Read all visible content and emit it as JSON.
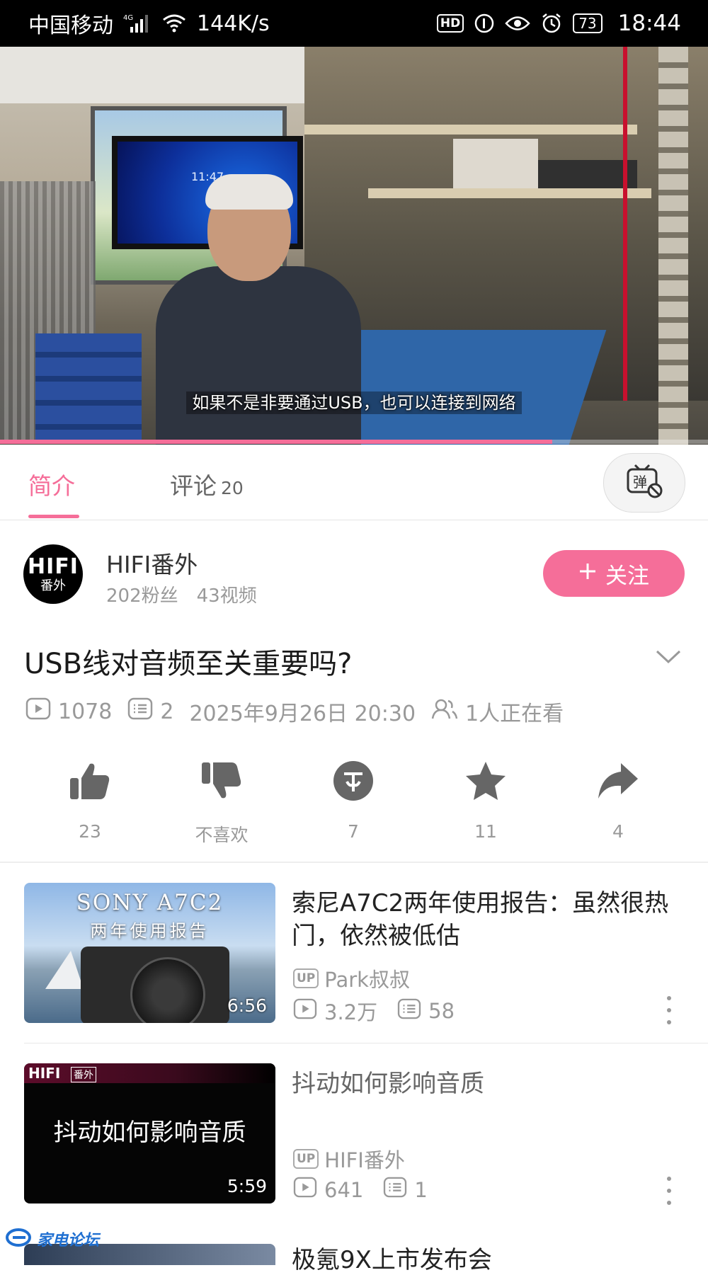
{
  "status_bar": {
    "carrier": "中国移动",
    "network": "4G",
    "speed": "144K/s",
    "battery": "73",
    "time": "18:44"
  },
  "player": {
    "subtitle": "如果不是非要通过USB，也可以连接到网络",
    "monitor_time": "11:47",
    "progress_fraction": 0.78
  },
  "tabs": {
    "intro": "简介",
    "comments": "评论",
    "comments_count": "20"
  },
  "uploader": {
    "avatar_line1": "HIFI",
    "avatar_line2": "番外",
    "name": "HIFI番外",
    "fans": "202粉丝",
    "videos": "43视频",
    "follow": "关注"
  },
  "video": {
    "title": "USB线对音频至关重要吗?",
    "views": "1078",
    "danmaku": "2",
    "date": "2025年9月26日 20:30",
    "watching": "1人正在看"
  },
  "actions": {
    "like": "23",
    "dislike": "不喜欢",
    "coin": "7",
    "favorite": "11",
    "share": "4"
  },
  "related": [
    {
      "thumb_title": "SONY A7C2",
      "thumb_sub": "两年使用报告",
      "duration": "6:56",
      "title": "索尼A7C2两年使用报告：虽然很热门，依然被低估",
      "up_tag": "UP",
      "uploader": "Park叔叔",
      "views": "3.2万",
      "danmaku": "58"
    },
    {
      "thumb_brand": "HIFI",
      "thumb_brand2": "番外",
      "thumb_title": "抖动如何影响音质",
      "duration": "5:59",
      "title": "抖动如何影响音质",
      "up_tag": "UP",
      "uploader": "HIFI番外",
      "views": "641",
      "danmaku": "1"
    },
    {
      "title": "极氪9X上市发布会"
    }
  ],
  "watermark": "家电论坛",
  "colors": {
    "accent": "#f56e99",
    "muted": "#999999"
  }
}
